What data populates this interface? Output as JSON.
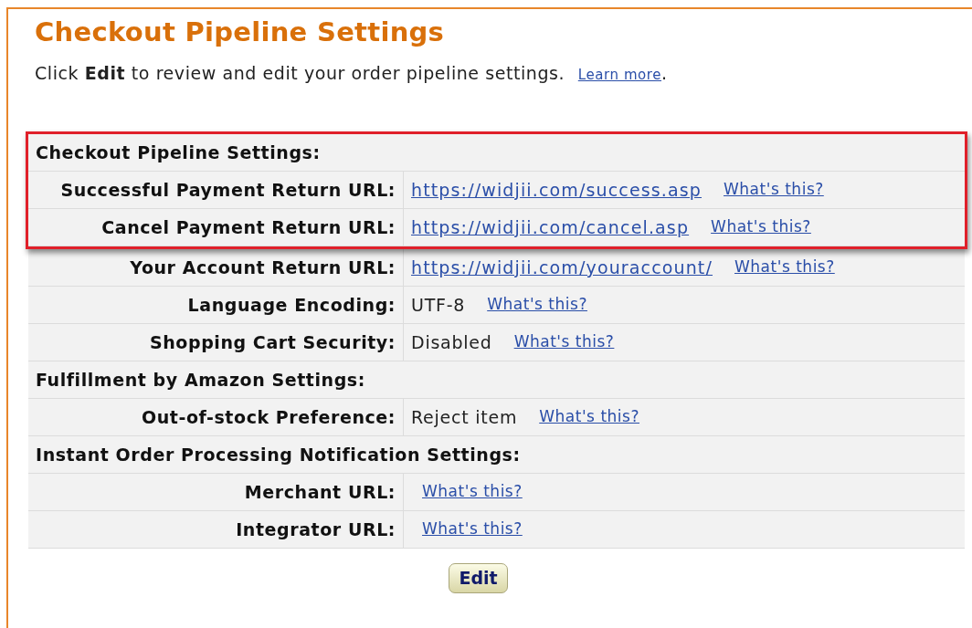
{
  "page": {
    "title": "Checkout Pipeline Settings",
    "intro": "Click **Edit** to review and edit your order pipeline settings.",
    "learn_more": "Learn more",
    "learn_more_after": "."
  },
  "table": {
    "rows": [
      {
        "kind": "section",
        "label": "Checkout Pipeline Settings:",
        "highlighted": true
      },
      {
        "kind": "field",
        "label": "Successful Payment Return URL:",
        "url": "https://widjii.com/success.asp",
        "help": "What's this?",
        "highlighted": true
      },
      {
        "kind": "field",
        "label": "Cancel Payment Return URL:",
        "url": "https://widjii.com/cancel.asp",
        "help": "What's this?",
        "highlighted": true
      },
      {
        "kind": "field",
        "label": "Your Account Return URL:",
        "url": "https://widjii.com/youraccount/",
        "help": "What's this?",
        "highlighted": false
      },
      {
        "kind": "field",
        "label": "Language Encoding:",
        "value": "UTF-8",
        "help": "What's this?",
        "highlighted": false
      },
      {
        "kind": "field",
        "label": "Shopping Cart Security:",
        "value": "Disabled",
        "help": "What's this?",
        "highlighted": false
      },
      {
        "kind": "section",
        "label": "Fulfillment by Amazon Settings:",
        "highlighted": false
      },
      {
        "kind": "field",
        "label": "Out-of-stock Preference:",
        "value": "Reject item",
        "help": "What's this?",
        "highlighted": false
      },
      {
        "kind": "section",
        "label": "Instant Order Processing Notification Settings:",
        "highlighted": false
      },
      {
        "kind": "field",
        "label": "Merchant URL:",
        "help": "What's this?",
        "highlighted": false
      },
      {
        "kind": "field",
        "label": "Integrator URL:",
        "help": "What's this?",
        "highlighted": false
      }
    ]
  },
  "edit_button": "Edit"
}
